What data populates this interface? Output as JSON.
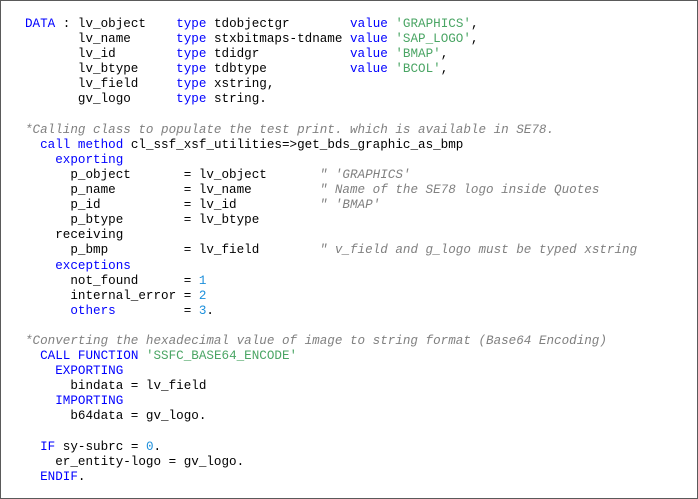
{
  "editor": {
    "lines": [
      [
        {
          "t": "DATA",
          "c": "kw"
        },
        {
          "t": " : ",
          "c": "id"
        },
        {
          "t": "lv_object",
          "c": "id"
        },
        {
          "t": "    ",
          "c": "id"
        },
        {
          "t": "type",
          "c": "kw"
        },
        {
          "t": " tdobjectgr        ",
          "c": "id"
        },
        {
          "t": "value",
          "c": "kw"
        },
        {
          "t": " ",
          "c": "id"
        },
        {
          "t": "'GRAPHICS'",
          "c": "str"
        },
        {
          "t": ",",
          "c": "id"
        }
      ],
      [
        {
          "t": "       lv_name      ",
          "c": "id"
        },
        {
          "t": "type",
          "c": "kw"
        },
        {
          "t": " stxbitmaps-tdname ",
          "c": "id"
        },
        {
          "t": "value",
          "c": "kw"
        },
        {
          "t": " ",
          "c": "id"
        },
        {
          "t": "'SAP_LOGO'",
          "c": "str"
        },
        {
          "t": ",",
          "c": "id"
        }
      ],
      [
        {
          "t": "       lv_id        ",
          "c": "id"
        },
        {
          "t": "type",
          "c": "kw"
        },
        {
          "t": " tdidgr            ",
          "c": "id"
        },
        {
          "t": "value",
          "c": "kw"
        },
        {
          "t": " ",
          "c": "id"
        },
        {
          "t": "'BMAP'",
          "c": "str"
        },
        {
          "t": ",",
          "c": "id"
        }
      ],
      [
        {
          "t": "       lv_btype     ",
          "c": "id"
        },
        {
          "t": "type",
          "c": "kw"
        },
        {
          "t": " tdbtype           ",
          "c": "id"
        },
        {
          "t": "value",
          "c": "kw"
        },
        {
          "t": " ",
          "c": "id"
        },
        {
          "t": "'BCOL'",
          "c": "str"
        },
        {
          "t": ",",
          "c": "id"
        }
      ],
      [
        {
          "t": "       lv_field     ",
          "c": "id"
        },
        {
          "t": "type",
          "c": "kw"
        },
        {
          "t": " xstring,",
          "c": "id"
        }
      ],
      [
        {
          "t": "       gv_logo      ",
          "c": "id"
        },
        {
          "t": "type",
          "c": "kw"
        },
        {
          "t": " string.",
          "c": "id"
        }
      ],
      [],
      [
        {
          "t": "*Calling class to populate the test print. which is available in SE78.",
          "c": "cm"
        }
      ],
      [
        {
          "t": "  ",
          "c": "id"
        },
        {
          "t": "call method",
          "c": "kw"
        },
        {
          "t": " cl_ssf_xsf_utilities=>get_bds_graphic_as_bmp",
          "c": "id"
        }
      ],
      [
        {
          "t": "    ",
          "c": "id"
        },
        {
          "t": "exporting",
          "c": "kw"
        }
      ],
      [
        {
          "t": "      p_object       = lv_object       ",
          "c": "id"
        },
        {
          "t": "\" 'GRAPHICS'",
          "c": "cm"
        }
      ],
      [
        {
          "t": "      p_name         = lv_name         ",
          "c": "id"
        },
        {
          "t": "\" Name of the SE78 logo inside Quotes",
          "c": "cm"
        }
      ],
      [
        {
          "t": "      p_id           = lv_id           ",
          "c": "id"
        },
        {
          "t": "\" 'BMAP'",
          "c": "cm"
        }
      ],
      [
        {
          "t": "      p_btype        = lv_btype",
          "c": "id"
        }
      ],
      [
        {
          "t": "    receiving",
          "c": "id"
        }
      ],
      [
        {
          "t": "      p_bmp          = lv_field        ",
          "c": "id"
        },
        {
          "t": "\" v_field and g_logo must be typed xstring",
          "c": "cm"
        }
      ],
      [
        {
          "t": "    ",
          "c": "id"
        },
        {
          "t": "exceptions",
          "c": "kw"
        }
      ],
      [
        {
          "t": "      not_found      = ",
          "c": "id"
        },
        {
          "t": "1",
          "c": "num"
        }
      ],
      [
        {
          "t": "      internal_error = ",
          "c": "id"
        },
        {
          "t": "2",
          "c": "num"
        }
      ],
      [
        {
          "t": "      ",
          "c": "id"
        },
        {
          "t": "others",
          "c": "kw"
        },
        {
          "t": "         = ",
          "c": "id"
        },
        {
          "t": "3",
          "c": "num"
        },
        {
          "t": ".",
          "c": "id"
        }
      ],
      [],
      [
        {
          "t": "*Converting the hexadecimal value of image to string format (Base64 Encoding)",
          "c": "cm"
        }
      ],
      [
        {
          "t": "  ",
          "c": "id"
        },
        {
          "t": "CALL FUNCTION",
          "c": "kw"
        },
        {
          "t": " ",
          "c": "id"
        },
        {
          "t": "'SSFC_BASE64_ENCODE'",
          "c": "str"
        }
      ],
      [
        {
          "t": "    ",
          "c": "id"
        },
        {
          "t": "EXPORTING",
          "c": "kw"
        }
      ],
      [
        {
          "t": "      bindata = lv_field",
          "c": "id"
        }
      ],
      [
        {
          "t": "    ",
          "c": "id"
        },
        {
          "t": "IMPORTING",
          "c": "kw"
        }
      ],
      [
        {
          "t": "      b64data = gv_logo.",
          "c": "id"
        }
      ],
      [],
      [
        {
          "t": "  ",
          "c": "id"
        },
        {
          "t": "IF",
          "c": "kw"
        },
        {
          "t": " sy-subrc = ",
          "c": "id"
        },
        {
          "t": "0",
          "c": "num"
        },
        {
          "t": ".",
          "c": "id"
        }
      ],
      [
        {
          "t": "    er_entity-logo = gv_logo.",
          "c": "id"
        }
      ],
      [
        {
          "t": "  ",
          "c": "id"
        },
        {
          "t": "ENDIF",
          "c": "kw"
        },
        {
          "t": ".",
          "c": "id"
        }
      ]
    ]
  },
  "colors": {
    "keyword": "#0000ff",
    "string": "#4aa564",
    "number": "#1c8fdb",
    "comment": "#808080",
    "text": "#000000",
    "border": "#5a5a5a"
  }
}
